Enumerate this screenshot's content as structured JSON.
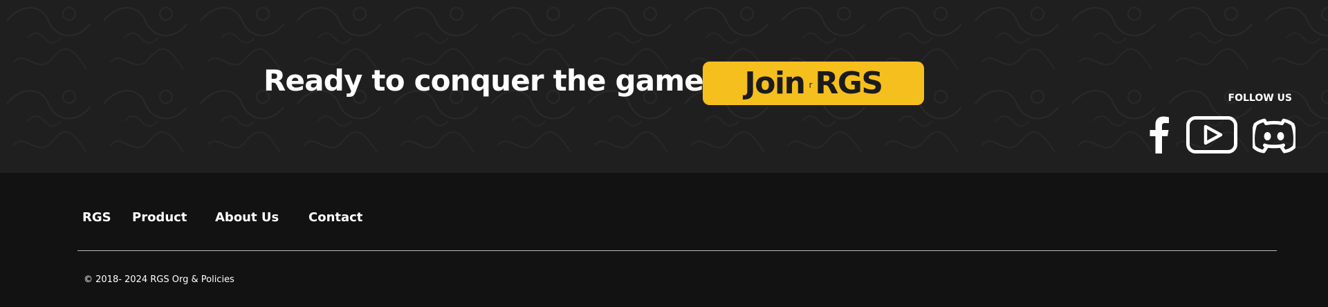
{
  "cta": {
    "heading": "Ready to conquer the game?",
    "join_button": {
      "word1": "Join",
      "separator": "r",
      "word2": "RGS"
    },
    "follow_label": "FOLLOW US",
    "socials": [
      {
        "name": "facebook",
        "icon": "facebook-icon"
      },
      {
        "name": "youtube",
        "icon": "youtube-icon"
      },
      {
        "name": "discord",
        "icon": "discord-icon"
      }
    ]
  },
  "footer": {
    "nav": {
      "brand": "RGS",
      "product": "Product",
      "about": "About Us",
      "contact": "Contact"
    },
    "copyright": "© 2018- 2024 RGS Org & Policies"
  },
  "colors": {
    "cta_background": "#1f1f1f",
    "footer_background": "#121212",
    "accent": "#f5bf1d",
    "text": "#ffffff",
    "button_text": "#1b1b1b"
  }
}
